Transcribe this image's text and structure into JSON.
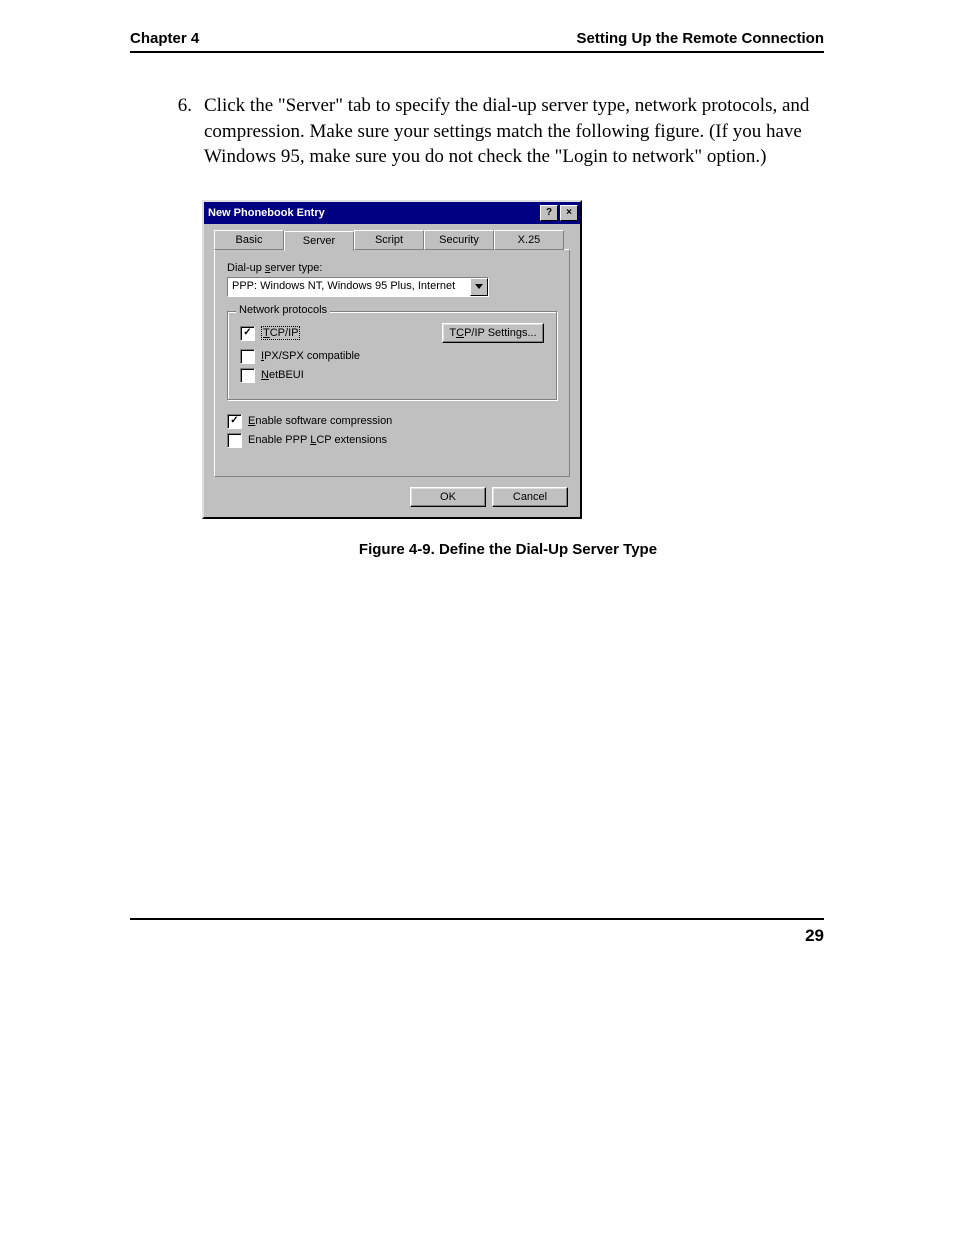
{
  "header": {
    "left": "Chapter 4",
    "right": "Setting Up the Remote Connection"
  },
  "step": {
    "num": "6.",
    "text": "Click the \"Server\" tab to specify the dial-up server type, network protocols, and compression. Make sure your settings match the following figure. (If you have Windows 95, make sure you do not check the \"Login to network\" option.)"
  },
  "dialog": {
    "title": "New Phonebook Entry",
    "help_btn": "?",
    "close_btn": "×",
    "tabs": [
      "Basic",
      "Server",
      "Script",
      "Security",
      "X.25"
    ],
    "active_tab": 1,
    "server_type_label_pre": "Dial-up ",
    "server_type_ul": "s",
    "server_type_label_post": "erver type:",
    "server_type_value": "PPP: Windows NT, Windows 95 Plus, Internet",
    "group_legend": "Network protocols",
    "tcpip_ul": "T",
    "tcpip_rest": "CP/IP",
    "tcpip_settings_pre": "T",
    "tcpip_settings_ul": "C",
    "tcpip_settings_post": "P/IP Settings...",
    "ipxspx_ul": "I",
    "ipxspx_rest": "PX/SPX compatible",
    "netbeui_ul": "N",
    "netbeui_rest": "etBEUI",
    "swcomp_ul": "E",
    "swcomp_rest": "nable software compression",
    "lcp_pre": "Enable PPP ",
    "lcp_ul": "L",
    "lcp_post": "CP extensions",
    "ok": "OK",
    "cancel": "Cancel"
  },
  "caption": "Figure 4-9.  Define the Dial-Up Server Type",
  "page_number": "29"
}
